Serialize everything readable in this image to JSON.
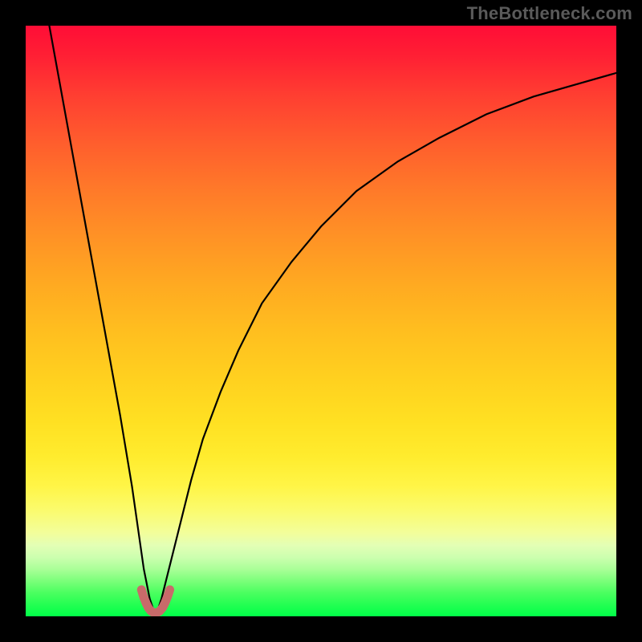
{
  "attribution": "TheBottleneck.com",
  "chart_data": {
    "type": "line",
    "title": "",
    "xlabel": "",
    "ylabel": "",
    "xlim": [
      0,
      100
    ],
    "ylim": [
      0,
      100
    ],
    "x_optimum_pct": 22,
    "series": [
      {
        "name": "left-branch",
        "x": [
          4,
          6,
          8,
          10,
          12,
          14,
          16,
          18,
          19,
          20,
          21,
          22
        ],
        "values": [
          100,
          89,
          78,
          67,
          56,
          45,
          34,
          22,
          15,
          8,
          3,
          0
        ]
      },
      {
        "name": "right-branch",
        "x": [
          22,
          23,
          24,
          26,
          28,
          30,
          33,
          36,
          40,
          45,
          50,
          56,
          63,
          70,
          78,
          86,
          93,
          100
        ],
        "values": [
          0,
          3,
          7,
          15,
          23,
          30,
          38,
          45,
          53,
          60,
          66,
          72,
          77,
          81,
          85,
          88,
          90,
          92
        ]
      }
    ],
    "marker": {
      "name": "optimum-u-marker",
      "color": "#c86a6a",
      "x": [
        19.6,
        20.0,
        20.4,
        20.8,
        21.2,
        21.7,
        22.2,
        22.7,
        23.2,
        23.6,
        24.0,
        24.4
      ],
      "values": [
        4.5,
        3.2,
        2.2,
        1.4,
        0.9,
        0.6,
        0.6,
        0.9,
        1.5,
        2.3,
        3.3,
        4.5
      ]
    },
    "gradient_stops": [
      {
        "pct": 0,
        "color": "#ff0d36"
      },
      {
        "pct": 50,
        "color": "#ffc81f"
      },
      {
        "pct": 82,
        "color": "#fbfb6d"
      },
      {
        "pct": 100,
        "color": "#00ff48"
      }
    ]
  }
}
